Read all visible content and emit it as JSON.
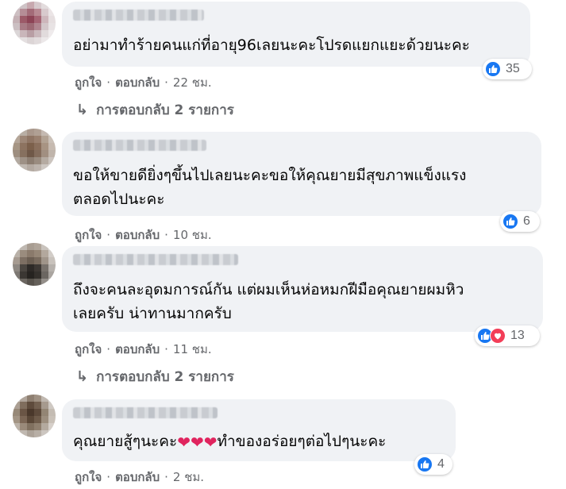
{
  "actions": {
    "like_label": "ถูกใจ",
    "reply_label": "ตอบกลับ",
    "separator": "·"
  },
  "comments": [
    {
      "text": "อย่ามาทำร้ายคนแก่ที่อายุ96เลยนะคะโปรดแยกแยะด้วยนะคะ",
      "reaction_count": "35",
      "reactions": [
        "like"
      ],
      "time": "22 ชม.",
      "replies_label": "การตอบกลับ 2 รายการ"
    },
    {
      "text": "ขอให้ขายดียิ่งๆขึ้นไปเลยนะคะขอให้คุณยายมีสุขภาพแข็งแรง\nตลอดไปนะคะ",
      "reaction_count": "6",
      "reactions": [
        "like"
      ],
      "time": "10 ชม."
    },
    {
      "text": "ถึงจะคนละอุดมการณ์กัน แต่ผมเห็นห่อหมกฝีมือคุณยายผมหิว\nเลยครับ น่าทานมากครับ",
      "reaction_count": "13",
      "reactions": [
        "like",
        "love"
      ],
      "time": "11 ชม.",
      "replies_label": "การตอบกลับ 2 รายการ"
    },
    {
      "text_before": "คุณยายสู้ๆนะคะ",
      "emoji": "❤❤❤",
      "text_after": "ทำของอร่อยๆต่อไปๆนะคะ",
      "reaction_count": "4",
      "reactions": [
        "like"
      ],
      "time": "2 ชม."
    }
  ],
  "colors": {
    "bubble": "#f0f2f5",
    "like": "#1877f2",
    "love": "#f33e58",
    "meta_text": "#65676b"
  }
}
